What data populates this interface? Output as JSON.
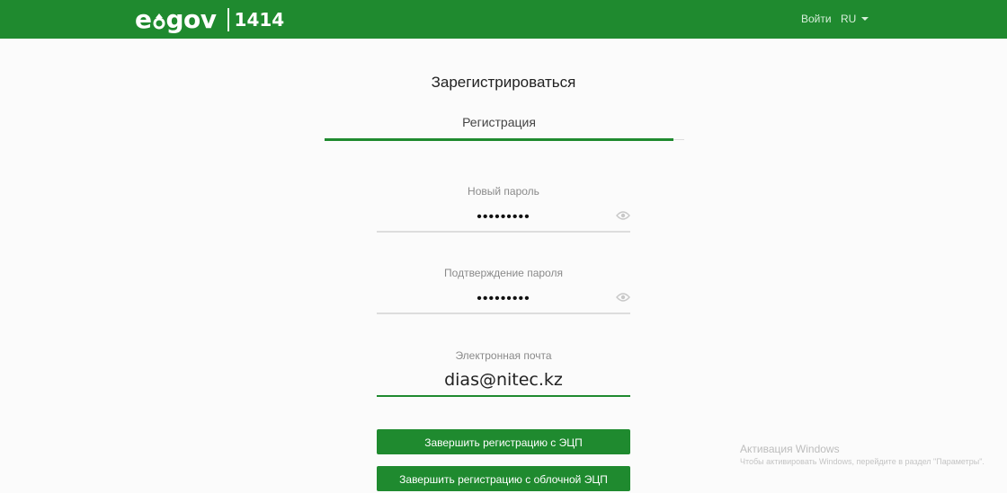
{
  "header": {
    "logo_text": "e",
    "logo_text2": "gov",
    "logo_number": "1414",
    "login_label": "Войти",
    "language": "RU",
    "background_color": "#1f8a2f"
  },
  "main": {
    "title": "Зарегистрироваться",
    "tab_label": "Регистрация",
    "fields": {
      "new_password": {
        "label": "Новый пароль",
        "value": "•••••••••",
        "icon": "eye-icon"
      },
      "confirm_password": {
        "label": "Подтверждение пароля",
        "value": "•••••••••",
        "icon": "eye-icon"
      },
      "email": {
        "label": "Электронная почта",
        "value": "dias@nitec.kz"
      }
    },
    "buttons": {
      "finish_ecp": "Завершить регистрацию с ЭЦП",
      "finish_cloud_ecp": "Завершить регистрацию с облочной ЭЦП"
    }
  },
  "windows_watermark": {
    "title": "Активация Windows",
    "subtitle": "Чтобы активировать Windows, перейдите в раздел \"Параметры\"."
  }
}
